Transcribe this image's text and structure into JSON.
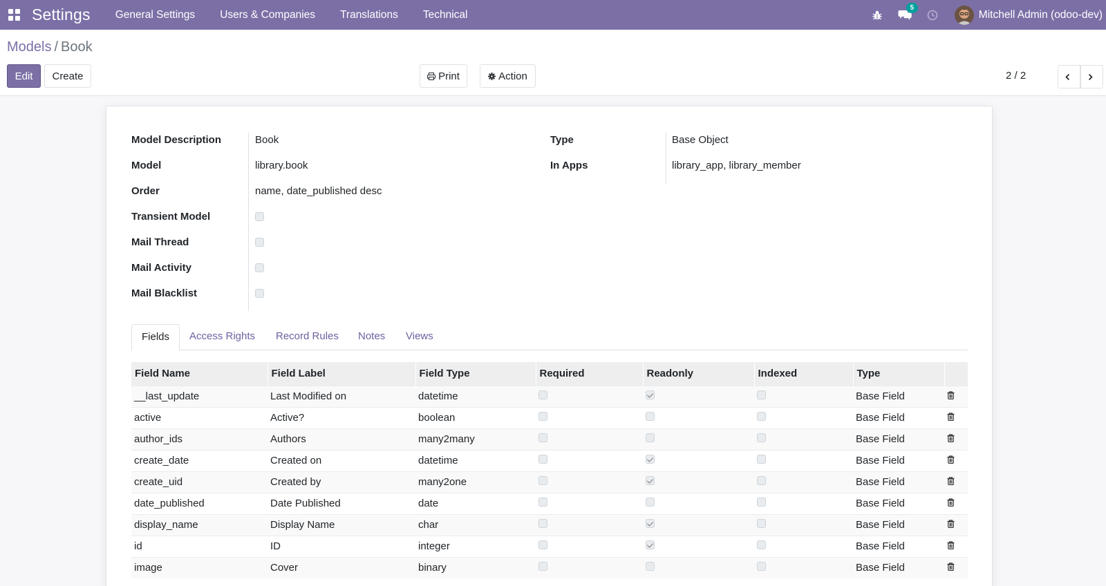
{
  "navbar": {
    "brand": "Settings",
    "menu": [
      "General Settings",
      "Users & Companies",
      "Translations",
      "Technical"
    ],
    "messages_badge": "5",
    "user_name": "Mitchell Admin (odoo-dev)"
  },
  "breadcrumb": {
    "parent": "Models",
    "separator": "/",
    "current": "Book"
  },
  "buttons": {
    "edit": "Edit",
    "create": "Create",
    "print": "Print",
    "action": "Action"
  },
  "pager": {
    "value": "2 / 2"
  },
  "form": {
    "left": [
      {
        "label": "Model Description",
        "value": "Book"
      },
      {
        "label": "Model",
        "value": "library.book"
      },
      {
        "label": "Order",
        "value": "name, date_published desc"
      }
    ],
    "checkboxes": [
      {
        "label": "Transient Model",
        "checked": false
      },
      {
        "label": "Mail Thread",
        "checked": false
      },
      {
        "label": "Mail Activity",
        "checked": false
      },
      {
        "label": "Mail Blacklist",
        "checked": false
      }
    ],
    "right": [
      {
        "label": "Type",
        "value": "Base Object"
      },
      {
        "label": "In Apps",
        "value": "library_app, library_member"
      }
    ]
  },
  "tabs": [
    "Fields",
    "Access Rights",
    "Record Rules",
    "Notes",
    "Views"
  ],
  "active_tab": "Fields",
  "table": {
    "columns": [
      "Field Name",
      "Field Label",
      "Field Type",
      "Required",
      "Readonly",
      "Indexed",
      "Type"
    ],
    "rows": [
      {
        "name": "__last_update",
        "label": "Last Modified on",
        "ftype": "datetime",
        "required": false,
        "readonly": true,
        "indexed": false,
        "type": "Base Field"
      },
      {
        "name": "active",
        "label": "Active?",
        "ftype": "boolean",
        "required": false,
        "readonly": false,
        "indexed": false,
        "type": "Base Field"
      },
      {
        "name": "author_ids",
        "label": "Authors",
        "ftype": "many2many",
        "required": false,
        "readonly": false,
        "indexed": false,
        "type": "Base Field"
      },
      {
        "name": "create_date",
        "label": "Created on",
        "ftype": "datetime",
        "required": false,
        "readonly": true,
        "indexed": false,
        "type": "Base Field"
      },
      {
        "name": "create_uid",
        "label": "Created by",
        "ftype": "many2one",
        "required": false,
        "readonly": true,
        "indexed": false,
        "type": "Base Field"
      },
      {
        "name": "date_published",
        "label": "Date Published",
        "ftype": "date",
        "required": false,
        "readonly": false,
        "indexed": false,
        "type": "Base Field"
      },
      {
        "name": "display_name",
        "label": "Display Name",
        "ftype": "char",
        "required": false,
        "readonly": true,
        "indexed": false,
        "type": "Base Field"
      },
      {
        "name": "id",
        "label": "ID",
        "ftype": "integer",
        "required": false,
        "readonly": true,
        "indexed": false,
        "type": "Base Field"
      },
      {
        "name": "image",
        "label": "Cover",
        "ftype": "binary",
        "required": false,
        "readonly": false,
        "indexed": false,
        "type": "Base Field"
      }
    ]
  },
  "colors": {
    "navbar": "#7c6fa6",
    "primary": "#7c6fa6",
    "badge": "#00a09d",
    "link": "#6f5fa0"
  }
}
